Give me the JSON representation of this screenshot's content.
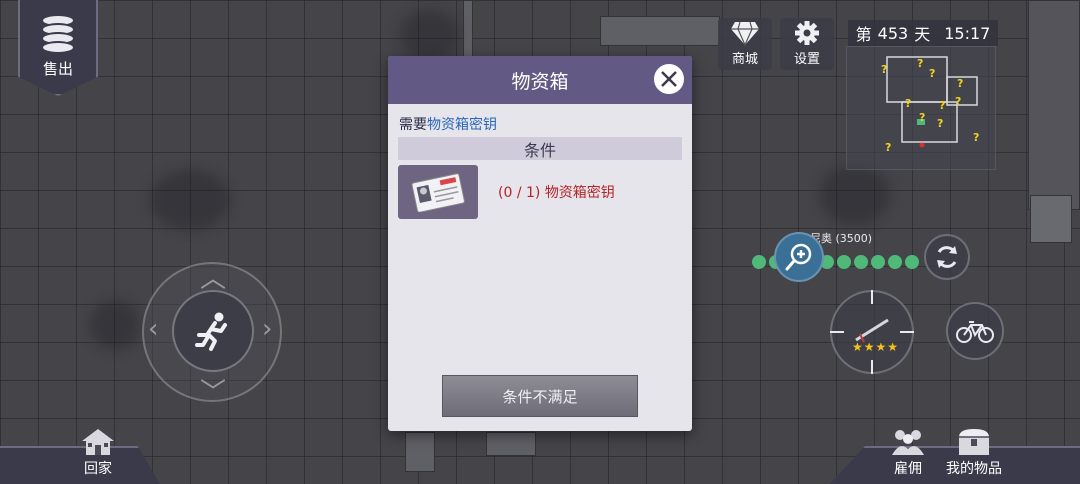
{
  "sell": {
    "label": "售出"
  },
  "top_buttons": {
    "shop_label": "商城",
    "settings_label": "设置"
  },
  "status": {
    "day_prefix": "第",
    "day_number": "453",
    "day_suffix": "天",
    "time": "15:17"
  },
  "character": {
    "name": "尼奥 (3500)",
    "stars": 4
  },
  "bottom_nav": {
    "home_label": "回家",
    "hire_label": "雇佣",
    "items_label": "我的物品"
  },
  "dialog": {
    "title": "物资箱",
    "requirement_prefix": "需要",
    "requirement_item": "物资箱密钥",
    "conditions_header": "条件",
    "condition_progress": "(0 / 1)",
    "condition_item": "物资箱密钥",
    "action_label": "条件不满足"
  },
  "colors": {
    "dialog_header": "#625a85",
    "condition_unmet": "#b42424",
    "highlight_item": "#2a67b8",
    "minimap_marker": "#f2d21b"
  }
}
